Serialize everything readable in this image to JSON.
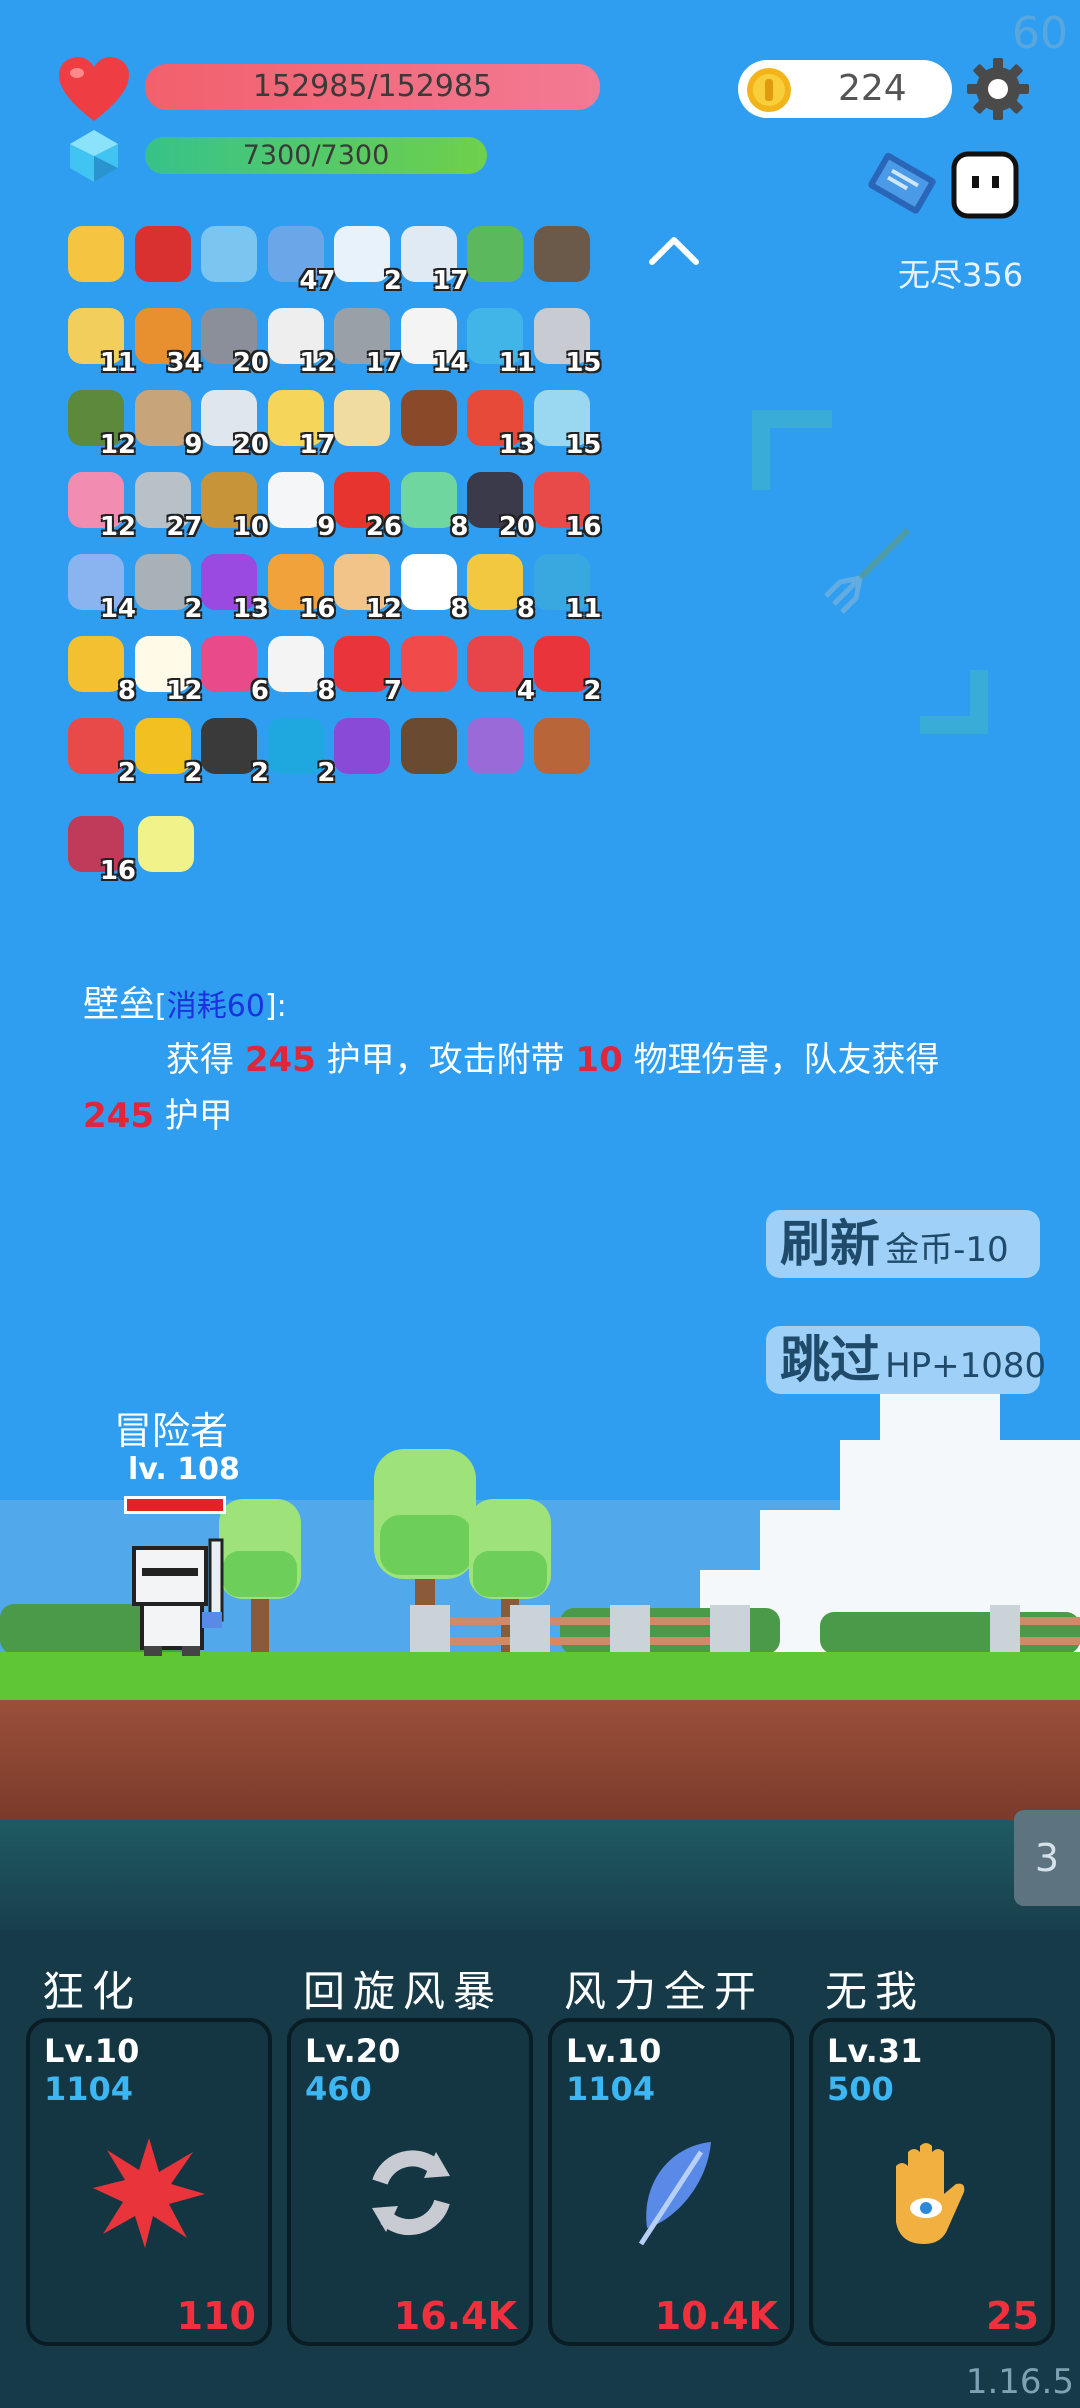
{
  "fps": "60",
  "player": {
    "hp_text": "152985/152985",
    "mp_text": "7300/7300",
    "hp_fill": 1.0,
    "mp_fill": 1.0
  },
  "coins": "224",
  "mode_label": "无尽356",
  "inventory": [
    {
      "icon": "sun-icon",
      "count": "",
      "color": "#f5c542"
    },
    {
      "icon": "magnet-icon",
      "count": "",
      "color": "#d93030"
    },
    {
      "icon": "magnifier-icon",
      "count": "",
      "color": "#7ac6f0"
    },
    {
      "icon": "star-card-icon",
      "count": "47",
      "color": "#6aa6e8"
    },
    {
      "icon": "cloud-icon",
      "count": "2",
      "color": "#e8f2fb"
    },
    {
      "icon": "cloud-icon",
      "count": "17",
      "color": "#dfeaf5"
    },
    {
      "icon": "money-heart-icon",
      "count": "",
      "color": "#5cb85c"
    },
    {
      "icon": "mortar-icon",
      "count": "",
      "color": "#6b5a4a"
    },
    {
      "icon": "scroll-icon",
      "count": "11",
      "color": "#f2cf5c"
    },
    {
      "icon": "book-icon",
      "count": "34",
      "color": "#e8902f"
    },
    {
      "icon": "dumbbell-icon",
      "count": "20",
      "color": "#8a8f99"
    },
    {
      "icon": "cards-icon",
      "count": "12",
      "color": "#eeeeee"
    },
    {
      "icon": "spiked-ball-icon",
      "count": "17",
      "color": "#9aa0a8"
    },
    {
      "icon": "dice-icon",
      "count": "14",
      "color": "#f4f4f4"
    },
    {
      "icon": "chat-bubble-icon",
      "count": "11",
      "color": "#41b4e8"
    },
    {
      "icon": "compass-icon",
      "count": "15",
      "color": "#c8ccd2"
    },
    {
      "icon": "grenade-icon",
      "count": "12",
      "color": "#5d8a3a"
    },
    {
      "icon": "noose-icon",
      "count": "9",
      "color": "#c8a47a"
    },
    {
      "icon": "stopwatch-icon",
      "count": "20",
      "color": "#dfe6ee"
    },
    {
      "icon": "halo-icon",
      "count": "17",
      "color": "#f5d65a"
    },
    {
      "icon": "map-icon",
      "count": "",
      "color": "#f0dca0"
    },
    {
      "icon": "chest-icon",
      "count": "",
      "color": "#8a4a2a"
    },
    {
      "icon": "gift-icon",
      "count": "13",
      "color": "#e84a3a"
    },
    {
      "icon": "potion-icon",
      "count": "15",
      "color": "#9ad8f2"
    },
    {
      "icon": "ice-cream-icon",
      "count": "12",
      "color": "#f28cb0"
    },
    {
      "icon": "sword-icon",
      "count": "27",
      "color": "#b8c0c8"
    },
    {
      "icon": "bow-icon",
      "count": "10",
      "color": "#c8943a"
    },
    {
      "icon": "envelope-icon",
      "count": "9",
      "color": "#f4f6f8"
    },
    {
      "icon": "apple-icon",
      "count": "26",
      "color": "#e8342f"
    },
    {
      "icon": "green-ghost-icon",
      "count": "8",
      "color": "#6fd6a0"
    },
    {
      "icon": "bat-icon",
      "count": "20",
      "color": "#3a3a4a"
    },
    {
      "icon": "thermometer-icon",
      "count": "16",
      "color": "#e84a4a"
    },
    {
      "icon": "pill-icon",
      "count": "14",
      "color": "#8ab4f0"
    },
    {
      "icon": "hook-icon",
      "count": "2",
      "color": "#a8b0b8"
    },
    {
      "icon": "crystal-ball-icon",
      "count": "13",
      "color": "#9a4ae0"
    },
    {
      "icon": "meteor-icon",
      "count": "16",
      "color": "#f2a23a"
    },
    {
      "icon": "fist-icon",
      "count": "12",
      "color": "#f2c48a"
    },
    {
      "icon": "ghost-icon",
      "count": "8",
      "color": "#ffffff"
    },
    {
      "icon": "ring-icon",
      "count": "8",
      "color": "#f2c840"
    },
    {
      "icon": "target-icon",
      "count": "11",
      "color": "#3aa8e0"
    },
    {
      "icon": "magic-wand-icon",
      "count": "8",
      "color": "#f2c030"
    },
    {
      "icon": "egg-icon",
      "count": "12",
      "color": "#fffbe8"
    },
    {
      "icon": "jam-jar-icon",
      "count": "6",
      "color": "#e84a8a"
    },
    {
      "icon": "flower-pot-icon",
      "count": "8",
      "color": "#f4f4f4"
    },
    {
      "icon": "strawberry-icon",
      "count": "7",
      "color": "#e8343a"
    },
    {
      "icon": "heart-icon",
      "count": "",
      "color": "#f04a4a"
    },
    {
      "icon": "capsule-icon",
      "count": "4",
      "color": "#e8454a"
    },
    {
      "icon": "broken-heart-icon",
      "count": "2",
      "color": "#e8343a"
    },
    {
      "icon": "watermelon-icon",
      "count": "2",
      "color": "#e84a4a"
    },
    {
      "icon": "sunflower-icon",
      "count": "2",
      "color": "#f2c020"
    },
    {
      "icon": "cauldron-icon",
      "count": "2",
      "color": "#3a3a3a"
    },
    {
      "icon": "gem-icon",
      "count": "2",
      "color": "#1fa8e0"
    },
    {
      "icon": "treasure-box-icon",
      "count": "",
      "color": "#8a4ad8"
    },
    {
      "icon": "coconut-icon",
      "count": "",
      "color": "#6a4a30"
    },
    {
      "icon": "shield-icon",
      "count": "",
      "color": "#9a6ad8"
    },
    {
      "icon": "round-shield-icon",
      "count": "",
      "color": "#b8653a"
    }
  ],
  "extra_items": [
    {
      "icon": "blade-icon",
      "count": "16",
      "color": "#c03a5a"
    },
    {
      "icon": "lightbulb-icon",
      "count": "",
      "color": "#f2f28a"
    }
  ],
  "skill_desc": {
    "name": "壁垒",
    "cost_open": "[",
    "cost": "消耗60",
    "cost_close": "]:",
    "line1_a": "获得",
    "line1_v1": "245",
    "line1_b": "护甲，攻击附带",
    "line1_v2": "10",
    "line1_c": "物理伤害，队友获得",
    "line2_v": "245",
    "line2_b": "护甲"
  },
  "buttons": {
    "refresh_big": "刷新",
    "refresh_small": "金币-10",
    "skip_big": "跳过",
    "skip_small": "HP+1080"
  },
  "hero": {
    "name": "冒险者",
    "level": "lv. 108"
  },
  "wave": "3",
  "skills": [
    {
      "name": "狂化",
      "lv": "Lv.10",
      "cost": "1104",
      "dmg": "110",
      "icon": "splat-icon",
      "color": "#e8343a"
    },
    {
      "name": "回旋风暴",
      "lv": "Lv.20",
      "cost": "460",
      "dmg": "16.4K",
      "icon": "whirlwind-icon",
      "color": "#c8ccd2"
    },
    {
      "name": "风力全开",
      "lv": "Lv.10",
      "cost": "1104",
      "dmg": "10.4K",
      "icon": "feather-icon",
      "color": "#5a8ae8"
    },
    {
      "name": "无我",
      "lv": "Lv.31",
      "cost": "500",
      "dmg": "25",
      "icon": "hamsa-icon",
      "color": "#f2b040"
    }
  ],
  "version": "1.16.5",
  "colors": {
    "hp": "#f2606c",
    "mp": "#37c28a",
    "sky": "#2f9ef0",
    "damage": "#e0263a"
  }
}
